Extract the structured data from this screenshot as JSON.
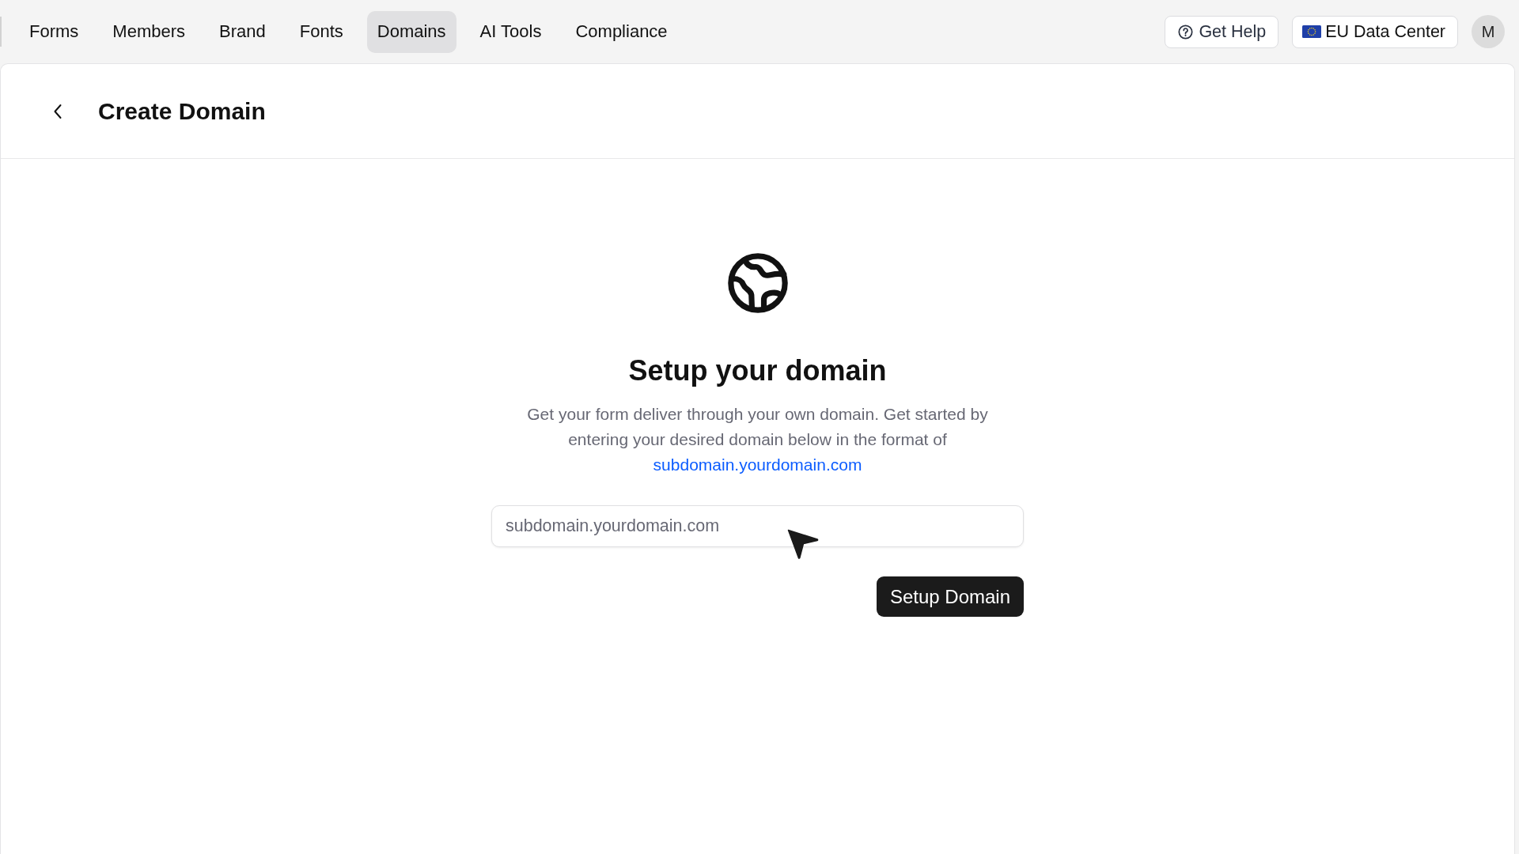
{
  "nav": {
    "tabs": [
      {
        "label": "Forms",
        "selected": false
      },
      {
        "label": "Members",
        "selected": false
      },
      {
        "label": "Brand",
        "selected": false
      },
      {
        "label": "Fonts",
        "selected": false
      },
      {
        "label": "Domains",
        "selected": true
      },
      {
        "label": "AI Tools",
        "selected": false
      },
      {
        "label": "Compliance",
        "selected": false
      }
    ],
    "help_button": "Get Help",
    "region_button": "EU Data Center",
    "avatar_initial": "M"
  },
  "page": {
    "title": "Create Domain"
  },
  "setup": {
    "heading": "Setup your domain",
    "description": "Get your form deliver through your own domain. Get started by entering your desired domain below in the format of",
    "link": "subdomain.yourdomain.com",
    "input": {
      "placeholder": "subdomain.yourdomain.com"
    },
    "button": "Setup Domain"
  }
}
